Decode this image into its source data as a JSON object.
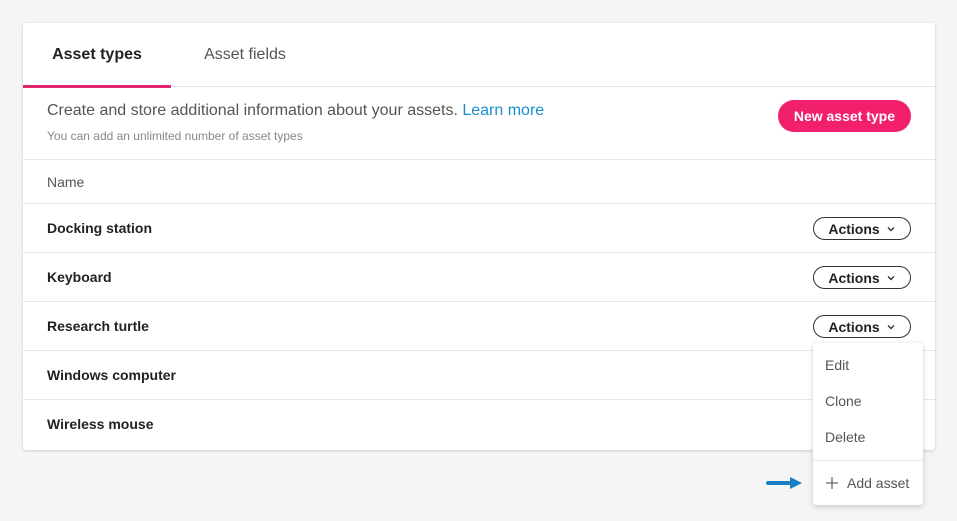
{
  "tabs": [
    {
      "label": "Asset types",
      "active": true
    },
    {
      "label": "Asset fields",
      "active": false
    }
  ],
  "info": {
    "description": "Create and store additional information about your assets.",
    "learn_more": "Learn more",
    "subtext": "You can add an unlimited number of asset types",
    "new_button": "New asset type"
  },
  "table": {
    "header": "Name",
    "rows": [
      {
        "name": "Docking station",
        "actions": "Actions"
      },
      {
        "name": "Keyboard",
        "actions": "Actions"
      },
      {
        "name": "Research turtle",
        "actions": "Actions"
      },
      {
        "name": "Windows computer"
      },
      {
        "name": "Wireless mouse"
      }
    ]
  },
  "dropdown": {
    "items": [
      "Edit",
      "Clone",
      "Delete"
    ],
    "add_label": "Add asset",
    "add_icon": "plus-icon"
  },
  "colors": {
    "accent": "#f21f6c",
    "tab_underline": "#e5246f",
    "link": "#1a8fd0",
    "pointer_arrow": "#1a7fc4"
  }
}
